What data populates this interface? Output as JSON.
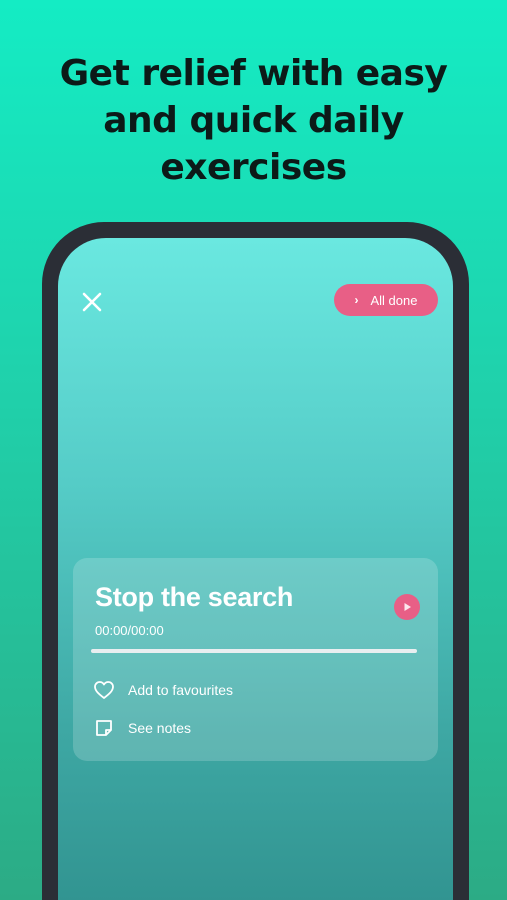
{
  "headline": {
    "line1": "Get relief with easy",
    "line2": "and quick daily",
    "line3": "exercises"
  },
  "toolbar": {
    "close_icon": "close-icon",
    "done_label": "All done",
    "done_icon": "chevron-right-icon"
  },
  "player": {
    "title": "Stop the search",
    "time": "00:00/00:00",
    "progress": 0,
    "play_icon": "play-icon",
    "favourite_label": "Add to favourites",
    "favourite_icon": "heart-icon",
    "notes_label": "See notes",
    "notes_icon": "note-icon"
  },
  "colors": {
    "background_top": "#14ecc4",
    "background_bottom": "#2cab85",
    "accent": "#e85f86",
    "device_frame": "#2b2e36",
    "text_dark": "#0c1a18"
  }
}
